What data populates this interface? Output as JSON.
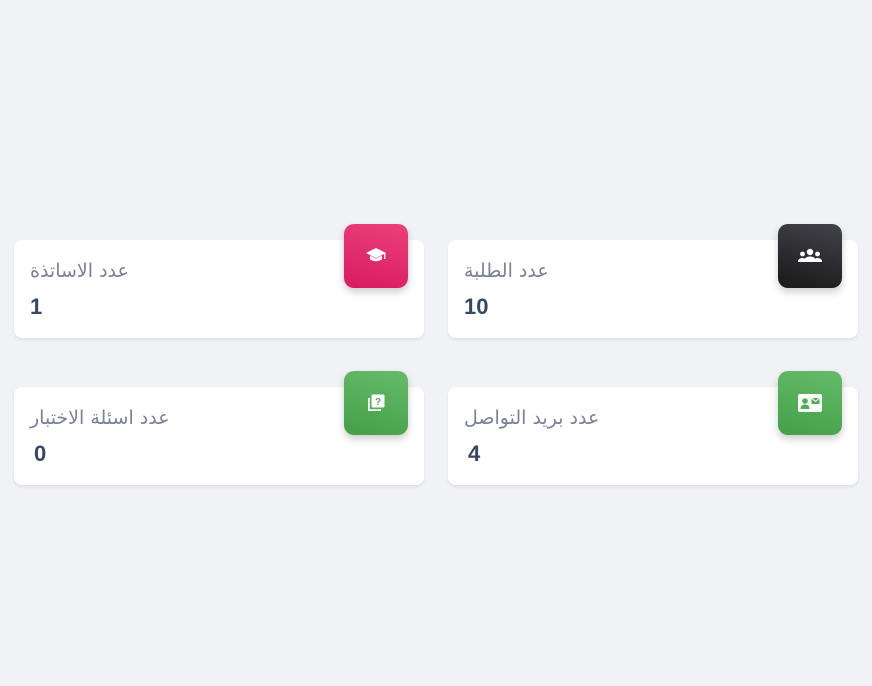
{
  "cards": [
    {
      "label": "عدد الاساتذة",
      "value": "1",
      "icon": "graduation-cap-icon",
      "color": "#e91e63"
    },
    {
      "label": "عدد الطلبة",
      "value": "10",
      "icon": "users-icon",
      "color": "#2b2b2f"
    },
    {
      "label": "عدد اسئلة الاختبار",
      "value": "0",
      "icon": "question-book-icon",
      "color": "#4caf50"
    },
    {
      "label": "عدد بريد التواصل",
      "value": "4",
      "icon": "contact-card-icon",
      "color": "#4caf50"
    }
  ]
}
